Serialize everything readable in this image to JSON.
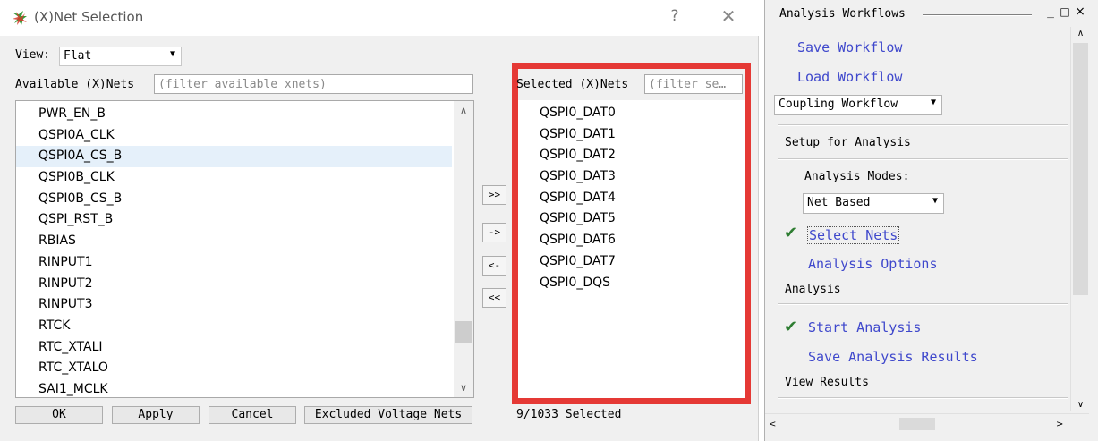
{
  "dialog": {
    "title": "(X)Net Selection",
    "help_label": "?",
    "close_label": "✕",
    "view_label": "View:",
    "view_value": "Flat",
    "available_label": "Available (X)Nets",
    "available_filter_placeholder": "(filter available xnets)",
    "available_nets": [
      "PWR_EN_B",
      "QSPI0A_CLK",
      "QSPI0A_CS_B",
      "QSPI0B_CLK",
      "QSPI0B_CS_B",
      "QSPI_RST_B",
      "RBIAS",
      "RINPUT1",
      "RINPUT2",
      "RINPUT3",
      "RTCK",
      "RTC_XTALI",
      "RTC_XTALO",
      "SAI1_MCLK"
    ],
    "highlighted_available": "QSPI0A_CS_B",
    "move_buttons": {
      "add_all": ">>",
      "add": "->",
      "remove": "<-",
      "remove_all": "<<"
    },
    "selected_label": "Selected (X)Nets",
    "selected_filter_placeholder": "(filter se…",
    "selected_nets": [
      "QSPI0_DAT0",
      "QSPI0_DAT1",
      "QSPI0_DAT2",
      "QSPI0_DAT3",
      "QSPI0_DAT4",
      "QSPI0_DAT5",
      "QSPI0_DAT6",
      "QSPI0_DAT7",
      "QSPI0_DQS"
    ],
    "buttons": {
      "ok": "OK",
      "apply": "Apply",
      "cancel": "Cancel",
      "excluded": "Excluded Voltage Nets"
    },
    "selected_count": "9/1033 Selected",
    "highlight_color": "#e53935"
  },
  "panel": {
    "title": "Analysis Workflows",
    "minimize_label": "_",
    "maximize_label": "□",
    "close_label": "×",
    "save_workflow": "Save Workflow",
    "load_workflow": "Load Workflow",
    "workflow_select": "Coupling Workflow",
    "setup_heading": "Setup for Analysis",
    "analysis_modes_label": "Analysis Modes:",
    "analysis_mode_value": "Net Based",
    "select_nets": "Select Nets",
    "analysis_options": "Analysis Options",
    "analysis_heading": "Analysis",
    "start_analysis": "Start Analysis",
    "save_results": "Save Analysis Results",
    "view_results_heading": "View Results",
    "link_color": "#3f48cc",
    "check_color": "#2e7d32"
  }
}
